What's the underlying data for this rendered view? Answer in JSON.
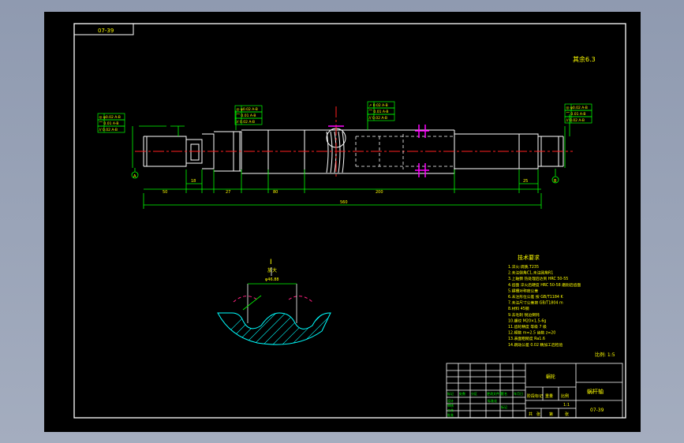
{
  "drawing": {
    "tab_label": "07-39",
    "top_right_note": "其余6.3",
    "section_label": "I",
    "section_label_sub": "放大",
    "section_dim": "φ46.88",
    "tech_title": "技术要求",
    "tech_lines": [
      "1.淬火:调质,T235",
      "2.未注倒角C1,未注圆角R1",
      "3.上轴颈 热处理后达到 HRC 50-55",
      "4.齿面 淬火后硬度 HRC 50-58 磨削后齿面",
      "5.键槽对称度公差",
      "6.未注形位公差 按 GB/T1184 K",
      "7.未注尺寸公差按 GB/T1804 m",
      "8.材料 45钢",
      "9.去毛刺 锐边倒钝",
      "10.螺纹 M20×1.5-6g",
      "11.齿轮精度 等级 7 级",
      "12.模数 m=2.5 齿数 z=20",
      "13.表面粗糙度 Ra1.6",
      "14.跳动公差 0.02 精加工后检验"
    ],
    "scale_note": "比例: 1:5",
    "title_block": {
      "part_name": "蜗轮",
      "drawing_title": "蜗杆轴",
      "drawing_no": "07-39",
      "material_cell": "标记",
      "stage_label": "阶段标记",
      "weight_label": "重量",
      "scale_label": "比例",
      "ratio": "1:1",
      "sheet_total": "共",
      "sheet_label": "张",
      "sheet_no": "第",
      "sheet_label2": "张",
      "row_labels": [
        "标记",
        "处数",
        "分区",
        "更改文件号",
        "签名",
        "年月日"
      ],
      "role_labels": [
        "设计",
        "审核",
        "工艺",
        "批准"
      ],
      "std_label": "标准化"
    },
    "dims": {
      "overall": "560",
      "seg1": "50",
      "seg2": "18",
      "seg3": "27",
      "seg4": "80",
      "seg5": "200",
      "seg6": "25"
    },
    "tolerance_frames": [
      {
        "rows": [
          "◎ φ0.02 A-B",
          "⌒ 0.01 A-B",
          "// 0.02 A-B"
        ]
      },
      {
        "rows": [
          "◎ φ0.02 A-B",
          "⌒ 0.01 A-B",
          "// 0.02 A-B"
        ]
      },
      {
        "rows": [
          "↗ 0.02 A-B",
          "⌒ 0.01 A-B",
          "// 0.02 A-B"
        ]
      },
      {
        "rows": [
          "◎ φ0.02 A-B",
          "⌒ 0.01 A-B",
          "// 0.02 A-B"
        ]
      }
    ],
    "datum_labels": [
      "A",
      "B"
    ]
  }
}
